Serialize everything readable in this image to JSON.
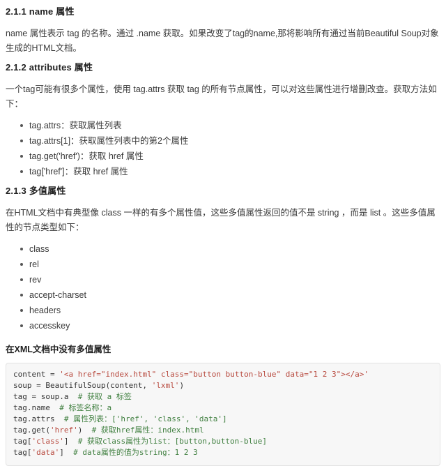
{
  "document": {
    "sections": [
      {
        "heading": "2.1.1 name 属性",
        "paragraph": "name 属性表示 tag 的名称。通过 .name 获取。如果改变了tag的name,那将影响所有通过当前Beautiful Soup对象生成的HTML文档。"
      },
      {
        "heading": "2.1.2 attributes 属性",
        "paragraph": "一个tag可能有很多个属性，使用 tag.attrs 获取 tag 的所有节点属性，可以对这些属性进行增删改查。获取方法如下：",
        "bullets": [
          "tag.attrs：获取属性列表",
          "tag.attrs[1]：获取属性列表中的第2个属性",
          "tag.get('href')：获取 href 属性",
          "tag['href']：获取 href 属性"
        ]
      },
      {
        "heading": "2.1.3 多值属性",
        "paragraph": "在HTML文档中有典型像 class 一样的有多个属性值，这些多值属性返回的值不是 string ，而是 list 。这些多值属性的节点类型如下：",
        "bullets": [
          "class",
          "rel",
          "rev",
          "accept-charset",
          "headers",
          "accesskey"
        ]
      }
    ],
    "note": "在XML文档中没有多值属性",
    "code_block": {
      "language": "python",
      "lines": [
        [
          {
            "t": "content = ",
            "c": "plain"
          },
          {
            "t": "'<a href=\"index.html\" class=\"button button-blue\" data=\"1 2 3\"></a>'",
            "c": "str"
          }
        ],
        [
          {
            "t": "soup = BeautifulSoup(content, ",
            "c": "plain"
          },
          {
            "t": "'lxml'",
            "c": "str"
          },
          {
            "t": ")",
            "c": "plain"
          }
        ],
        [
          {
            "t": "tag = soup.a  ",
            "c": "plain"
          },
          {
            "t": "# 获取 a 标签",
            "c": "com"
          }
        ],
        [
          {
            "t": "tag.name  ",
            "c": "plain"
          },
          {
            "t": "# 标签名称：a",
            "c": "com"
          }
        ],
        [
          {
            "t": "tag.attrs  ",
            "c": "plain"
          },
          {
            "t": "# 属性列表：['href', 'class', 'data']",
            "c": "com"
          }
        ],
        [
          {
            "t": "tag.get(",
            "c": "plain"
          },
          {
            "t": "'href'",
            "c": "str"
          },
          {
            "t": ")  ",
            "c": "plain"
          },
          {
            "t": "# 获取href属性：index.html",
            "c": "com"
          }
        ],
        [
          {
            "t": "tag[",
            "c": "plain"
          },
          {
            "t": "'class'",
            "c": "str"
          },
          {
            "t": "]  ",
            "c": "plain"
          },
          {
            "t": "# 获取class属性为list：[button,button-blue]",
            "c": "com"
          }
        ],
        [
          {
            "t": "tag[",
            "c": "plain"
          },
          {
            "t": "'data'",
            "c": "str"
          },
          {
            "t": "]  ",
            "c": "plain"
          },
          {
            "t": "# data属性的值为string：1 2 3",
            "c": "com"
          }
        ]
      ]
    },
    "colors": {
      "text": "#333333",
      "heading": "#222222",
      "code_background": "#f7f7f7",
      "code_border": "#e3e3e3",
      "string_token": "#b84a3f",
      "comment_token": "#3f7f3f"
    }
  }
}
